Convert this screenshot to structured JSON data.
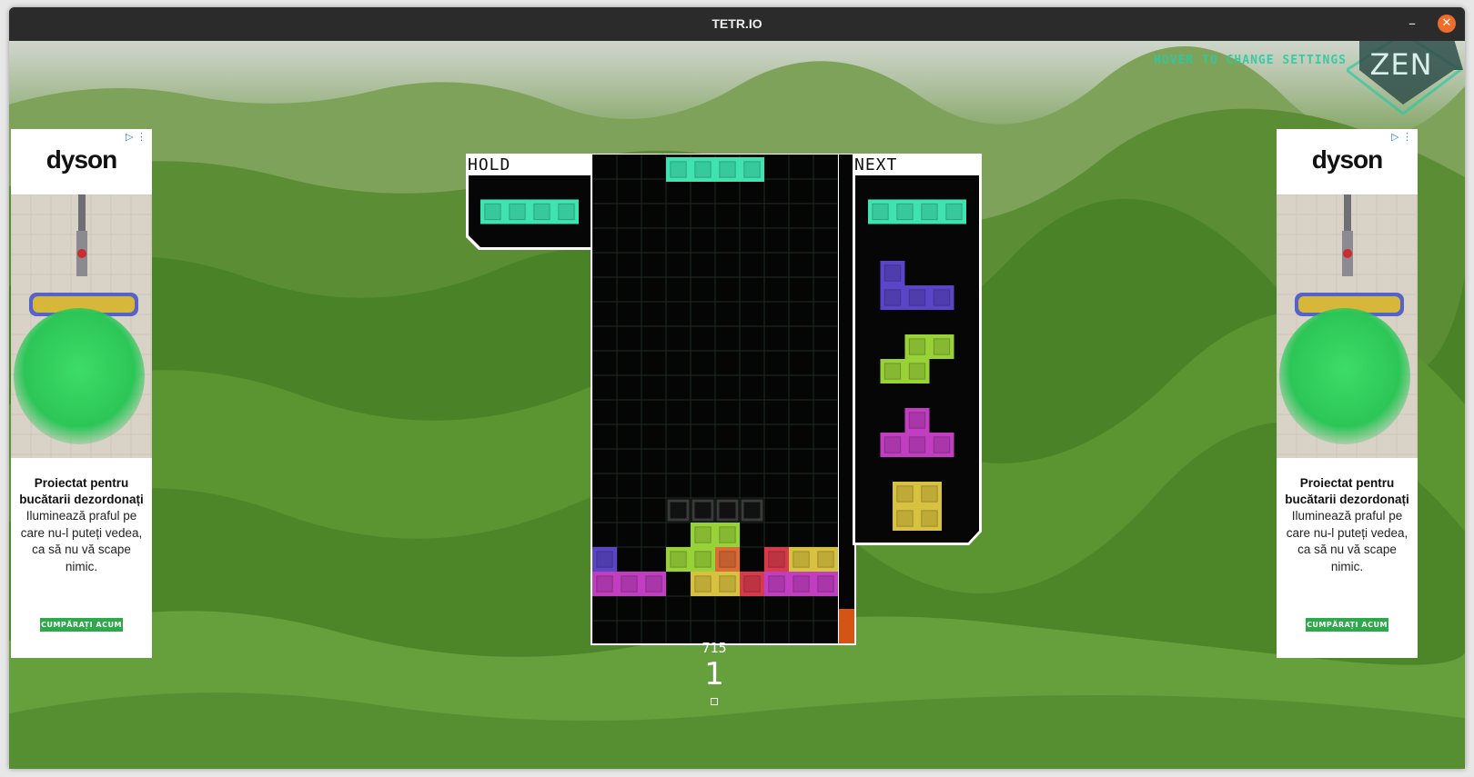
{
  "window": {
    "title": "TETR.IO",
    "minimize_glyph": "–",
    "close_glyph": "✕",
    "close_color": "#ec6d2c"
  },
  "mode": {
    "hint": "HOVER TO CHANGE SETTINGS",
    "label": "ZEN"
  },
  "hold": {
    "label": "HOLD",
    "piece": "I"
  },
  "next": {
    "label": "NEXT",
    "queue": [
      "I",
      "J",
      "S",
      "T",
      "O"
    ]
  },
  "board": {
    "columns": 10,
    "visible_rows": 20,
    "active_piece": {
      "type": "I",
      "cells": [
        [
          0,
          3
        ],
        [
          0,
          4
        ],
        [
          0,
          5
        ],
        [
          0,
          6
        ]
      ]
    },
    "ghost_cells": [
      [
        14,
        3
      ],
      [
        14,
        4
      ],
      [
        14,
        5
      ],
      [
        14,
        6
      ]
    ],
    "stack": [
      {
        "row": 15,
        "col": 4,
        "color": "S"
      },
      {
        "row": 15,
        "col": 5,
        "color": "S"
      },
      {
        "row": 16,
        "col": 0,
        "color": "J"
      },
      {
        "row": 16,
        "col": 3,
        "color": "S"
      },
      {
        "row": 16,
        "col": 4,
        "color": "S"
      },
      {
        "row": 16,
        "col": 5,
        "color": "L"
      },
      {
        "row": 16,
        "col": 7,
        "color": "Z"
      },
      {
        "row": 16,
        "col": 8,
        "color": "O"
      },
      {
        "row": 16,
        "col": 9,
        "color": "O"
      },
      {
        "row": 17,
        "col": 0,
        "color": "T"
      },
      {
        "row": 17,
        "col": 1,
        "color": "T"
      },
      {
        "row": 17,
        "col": 2,
        "color": "T"
      },
      {
        "row": 17,
        "col": 4,
        "color": "O"
      },
      {
        "row": 17,
        "col": 5,
        "color": "O"
      },
      {
        "row": 17,
        "col": 6,
        "color": "Z"
      },
      {
        "row": 17,
        "col": 7,
        "color": "T"
      },
      {
        "row": 17,
        "col": 8,
        "color": "T"
      },
      {
        "row": 17,
        "col": 9,
        "color": "T"
      }
    ]
  },
  "piece_colors": {
    "I": "#3ee3b0",
    "J": "#5a45c6",
    "S": "#98d138",
    "T": "#c13ec0",
    "O": "#d8c13e",
    "Z": "#d63a4b",
    "L": "#dc6c35"
  },
  "stats": {
    "score": "715",
    "lines": "1"
  },
  "garbage_meter": {
    "fill_fraction": 0.07,
    "color": "#d35414"
  },
  "ads": [
    {
      "brand": "dyson",
      "heading": "Proiectat pentru bucătarii dezordonați",
      "body": "Iluminează praful pe care nu-l puteți vedea, ca să nu vă scape nimic.",
      "cta": "CUMPĂRAȚI ACUM",
      "choices_glyph": "▷ ⋮"
    },
    {
      "brand": "dyson",
      "heading": "Proiectat pentru bucătarii dezordonați",
      "body": "Iluminează praful pe care nu-l puteți vedea, ca să nu vă scape nimic.",
      "cta": "CUMPĂRAȚI ACUM",
      "choices_glyph": "▷ ⋮"
    }
  ]
}
